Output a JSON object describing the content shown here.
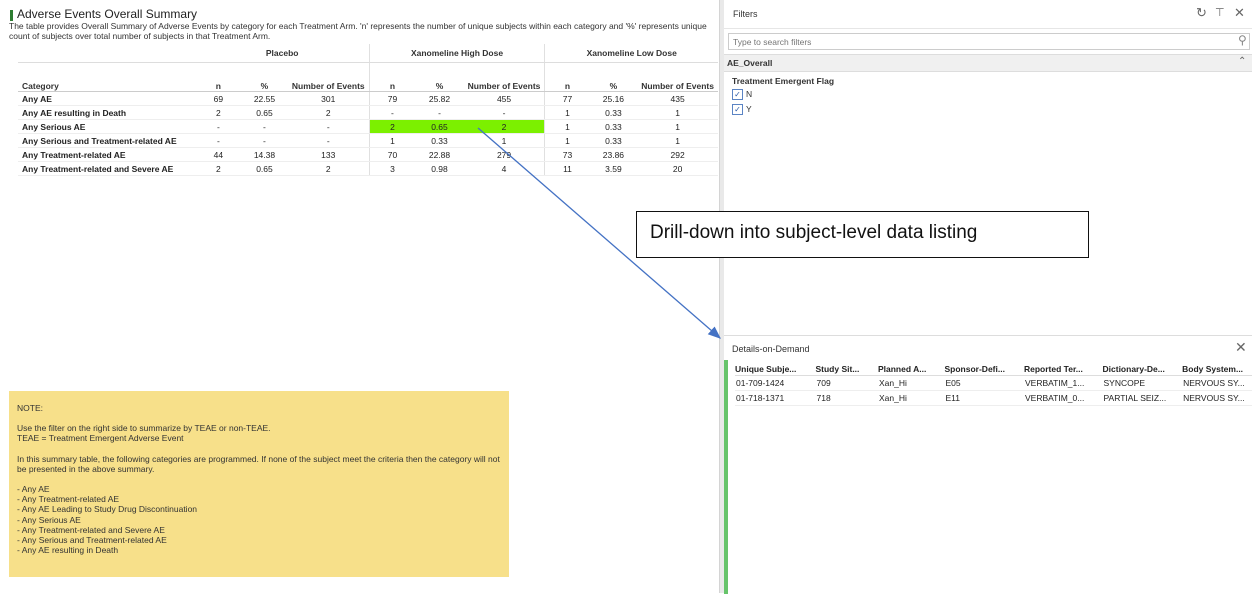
{
  "summary": {
    "title": "Adverse Events Overall Summary",
    "description": "The table provides Overall Summary of Adverse Events by category for each Treatment Arm. 'n' represents the number of unique subjects within each category and '%' represents unique count of subjects over total number of subjects in that Treatment Arm.",
    "arms": [
      "Placebo",
      "Xanomeline High Dose",
      "Xanomeline Low Dose"
    ],
    "category_header": "Category",
    "col_n": "n",
    "col_pct": "%",
    "col_events": "Number of Events",
    "rows": [
      {
        "cat": "Any AE",
        "v": [
          "69",
          "22.55",
          "301",
          "79",
          "25.82",
          "455",
          "77",
          "25.16",
          "435"
        ]
      },
      {
        "cat": "Any AE resulting in Death",
        "v": [
          "2",
          "0.65",
          "2",
          "-",
          "-",
          "-",
          "1",
          "0.33",
          "1"
        ]
      },
      {
        "cat": "Any Serious AE",
        "v": [
          "-",
          "-",
          "-",
          "2",
          "0.65",
          "2",
          "1",
          "0.33",
          "1"
        ]
      },
      {
        "cat": "Any Serious and Treatment-related AE",
        "v": [
          "-",
          "-",
          "-",
          "1",
          "0.33",
          "1",
          "1",
          "0.33",
          "1"
        ]
      },
      {
        "cat": "Any Treatment-related AE",
        "v": [
          "44",
          "14.38",
          "133",
          "70",
          "22.88",
          "279",
          "73",
          "23.86",
          "292"
        ]
      },
      {
        "cat": "Any Treatment-related and Severe AE",
        "v": [
          "2",
          "0.65",
          "2",
          "3",
          "0.98",
          "4",
          "11",
          "3.59",
          "20"
        ]
      }
    ],
    "highlight_color": "#7cf000"
  },
  "note": {
    "heading": "NOTE:",
    "p1": "Use the filter on the right side to summarize by TEAE or non-TEAE.",
    "p2": "TEAE = Treatment Emergent Adverse Event",
    "p3": "In this summary table, the following categories are programmed. If none of the subject meet the criteria then the category will not be presented in the above summary.",
    "items": [
      "- Any AE",
      "- Any Treatment-related AE",
      "- Any AE Leading to Study Drug Discontinuation",
      "- Any Serious AE",
      "- Any Treatment-related and Severe AE",
      "- Any Serious and Treatment-related AE",
      "- Any AE resulting in Death"
    ],
    "bg_color": "#f7e08a"
  },
  "filters": {
    "title": "Filters",
    "icons": [
      "reset-icon",
      "pin-icon",
      "close-icon"
    ],
    "search_placeholder": "Type to search filters",
    "section": "AE_Overall",
    "flag_title": "Treatment Emergent Flag",
    "options": [
      {
        "label": "N",
        "checked": true
      },
      {
        "label": "Y",
        "checked": true
      }
    ]
  },
  "callout": {
    "text": "Drill-down into subject-level data listing"
  },
  "details": {
    "title": "Details-on-Demand",
    "columns": [
      "Unique Subje...",
      "Study Sit...",
      "Planned A...",
      "Sponsor-Defi...",
      "Reported Ter...",
      "Dictionary-De...",
      "Body System..."
    ],
    "rows": [
      [
        "01-709-1424",
        "709",
        "Xan_Hi",
        "E05",
        "VERBATIM_1...",
        "SYNCOPE",
        "NERVOUS SY..."
      ],
      [
        "01-718-1371",
        "718",
        "Xan_Hi",
        "E11",
        "VERBATIM_0...",
        "PARTIAL SEIZ...",
        "NERVOUS SY..."
      ]
    ],
    "accent_color": "#67c46b"
  }
}
